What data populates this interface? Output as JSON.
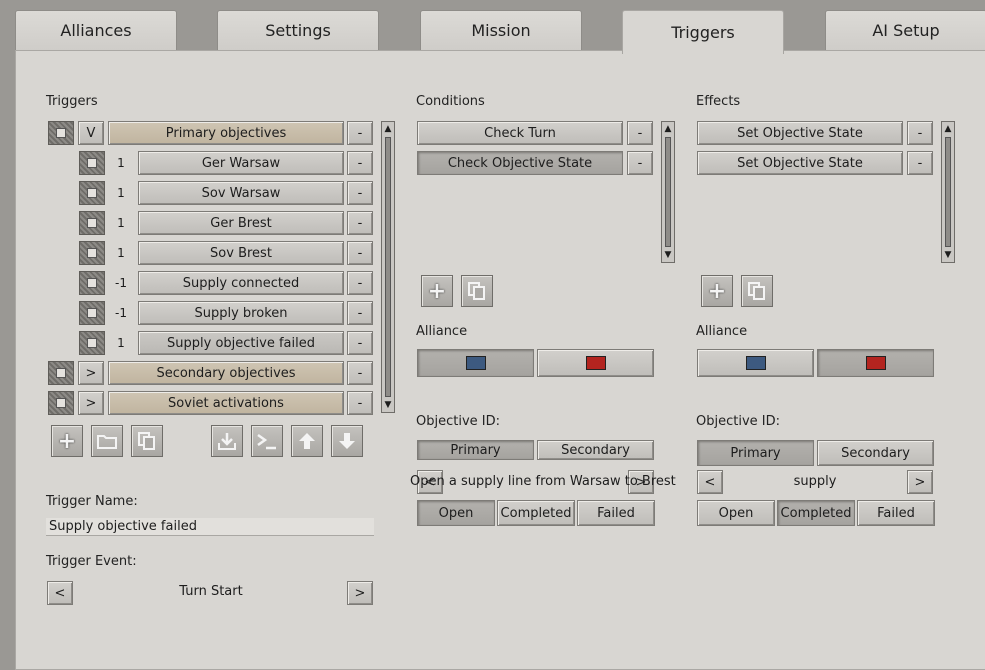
{
  "tabs": [
    "Alliances",
    "Settings",
    "Mission",
    "Triggers",
    "AI Setup"
  ],
  "active_tab": "Triggers",
  "triggers": {
    "header": "Triggers",
    "groups": [
      {
        "toggle": "V",
        "label": "Primary objectives",
        "remove": "-",
        "children": [
          {
            "num": "1",
            "label": "Ger Warsaw",
            "remove": "-"
          },
          {
            "num": "1",
            "label": "Sov Warsaw",
            "remove": "-"
          },
          {
            "num": "1",
            "label": "Ger Brest",
            "remove": "-"
          },
          {
            "num": "1",
            "label": "Sov Brest",
            "remove": "-"
          },
          {
            "num": "-1",
            "label": "Supply connected",
            "remove": "-"
          },
          {
            "num": "-1",
            "label": "Supply broken",
            "remove": "-"
          },
          {
            "num": "1",
            "label": "Supply objective failed",
            "remove": "-"
          }
        ]
      },
      {
        "toggle": ">",
        "label": "Secondary objectives",
        "remove": "-"
      },
      {
        "toggle": ">",
        "label": "Soviet activations",
        "remove": "-"
      }
    ],
    "toolbar_icons": [
      "plus-icon",
      "folder-icon",
      "copy-icon",
      "import-icon",
      "console-icon",
      "move-up-icon",
      "move-down-icon"
    ],
    "name_label": "Trigger Name:",
    "name_value": "Supply objective failed",
    "event_label": "Trigger Event:",
    "event_prev": "<",
    "event_value": "Turn Start",
    "event_next": ">"
  },
  "conditions": {
    "header": "Conditions",
    "items": [
      {
        "label": "Check Turn",
        "remove": "-"
      },
      {
        "label": "Check Objective State",
        "remove": "-"
      }
    ],
    "alliance_label": "Alliance",
    "alliance_colors": [
      "#3d5a80",
      "#b3241f"
    ],
    "objective_label": "Objective ID:",
    "objective_tabs": [
      "Primary",
      "Secondary"
    ],
    "nav_prev": "<",
    "objective_value": "Open a supply line from Warsaw to Brest",
    "nav_next": ">",
    "states": [
      "Open",
      "Completed",
      "Failed"
    ]
  },
  "effects": {
    "header": "Effects",
    "items": [
      {
        "label": "Set Objective State",
        "remove": "-"
      },
      {
        "label": "Set Objective State",
        "remove": "-"
      }
    ],
    "alliance_label": "Alliance",
    "alliance_colors": [
      "#3d5a80",
      "#b3241f"
    ],
    "objective_label": "Objective ID:",
    "objective_tabs": [
      "Primary",
      "Secondary"
    ],
    "nav_prev": "<",
    "objective_value": "supply",
    "nav_next": ">",
    "states": [
      "Open",
      "Completed",
      "Failed"
    ]
  }
}
